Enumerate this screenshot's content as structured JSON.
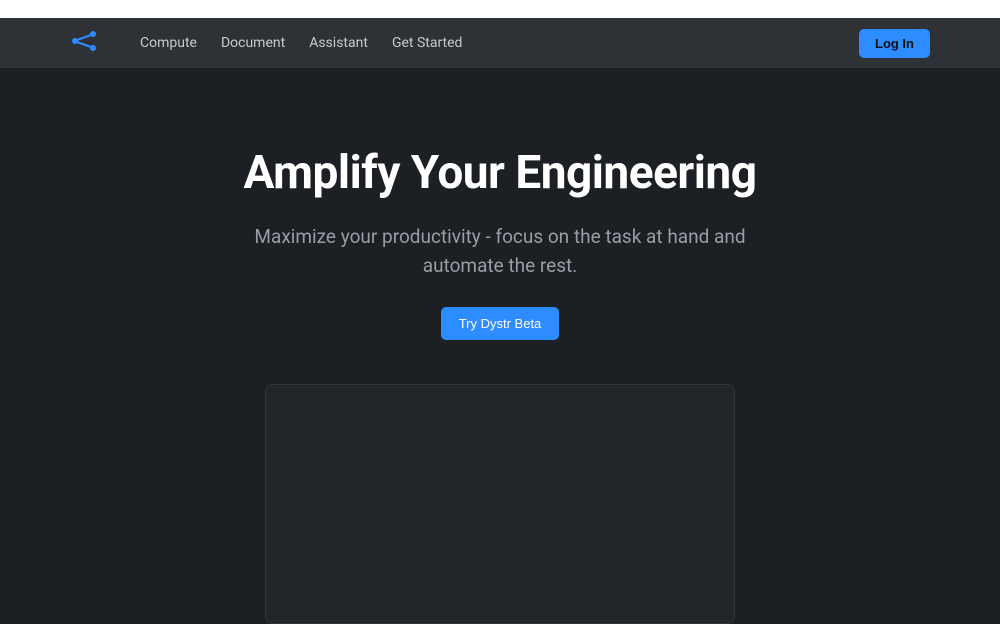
{
  "nav": {
    "items": [
      {
        "label": "Compute"
      },
      {
        "label": "Document"
      },
      {
        "label": "Assistant"
      },
      {
        "label": "Get Started"
      }
    ],
    "login_label": "Log In"
  },
  "hero": {
    "title": "Amplify Your Engineering",
    "subtitle": "Maximize your productivity - focus on the task at hand and automate the rest.",
    "cta_label": "Try Dystr Beta"
  },
  "colors": {
    "accent": "#2d8cff",
    "bg": "#1c1f24",
    "navbar": "#2e3136"
  }
}
